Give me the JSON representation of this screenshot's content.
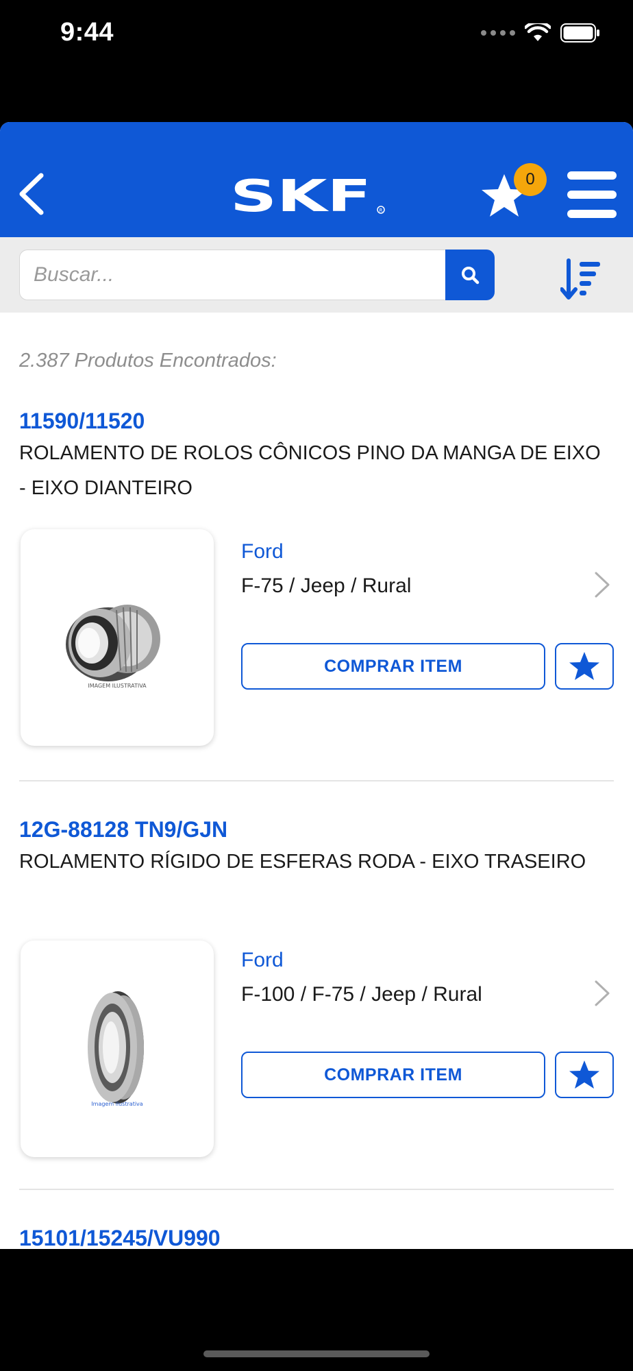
{
  "status_bar": {
    "time": "9:44"
  },
  "header": {
    "brand": "SKF",
    "favorites_count": "0"
  },
  "search": {
    "placeholder": "Buscar..."
  },
  "results_count": "2.387 Produtos Encontrados:",
  "products": [
    {
      "code": "11590/11520",
      "description": "ROLAMENTO DE ROLOS CÔNICOS PINO DA MANGA DE EIXO - EIXO DIANTEIRO",
      "brand": "Ford",
      "models": "F-75 / Jeep / Rural",
      "buy_label": "COMPRAR ITEM",
      "image_caption": "IMAGEM ILUSTRATIVA"
    },
    {
      "code": "12G-88128 TN9/GJN",
      "description": "ROLAMENTO RÍGIDO DE ESFERAS RODA - EIXO TRASEIRO",
      "brand": "Ford",
      "models": "F-100 / F-75 / Jeep / Rural",
      "buy_label": "COMPRAR ITEM",
      "image_caption": "Imagem ilustrativa"
    },
    {
      "code": "15101/15245/VU990"
    }
  ],
  "colors": {
    "primary": "#0f58d6",
    "badge": "#f5a60b",
    "search_bg": "#ececec"
  }
}
